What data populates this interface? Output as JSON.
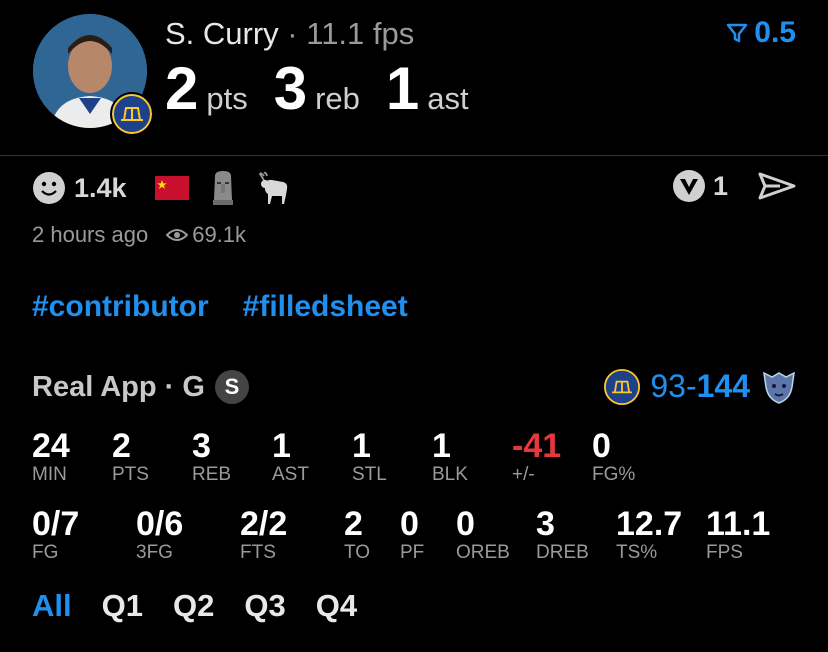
{
  "player": {
    "name": "S. Curry",
    "separator": " · ",
    "fps": "11.1 fps",
    "pts": "2",
    "pts_label": "pts",
    "reb": "3",
    "reb_label": "reb",
    "ast": "1",
    "ast_label": "ast"
  },
  "filter": {
    "icon": "filter-icon",
    "value": "0.5",
    "color": "#1f8ff0"
  },
  "reactions": {
    "smiley_count": "1.4k",
    "items": [
      "smiley-icon",
      "china-flag-icon",
      "moai-icon",
      "goat-icon"
    ]
  },
  "meta": {
    "time": "2 hours ago",
    "views": "69.1k"
  },
  "actions": {
    "vote_count": "1"
  },
  "tags": [
    "#contributor",
    "#filledsheet"
  ],
  "game": {
    "app": "Real App · G",
    "badge": "S",
    "home_score": "93",
    "dash": "-",
    "away_score": "144"
  },
  "row1": [
    {
      "v": "24",
      "l": "MIN"
    },
    {
      "v": "2",
      "l": "PTS"
    },
    {
      "v": "3",
      "l": "REB"
    },
    {
      "v": "1",
      "l": "AST"
    },
    {
      "v": "1",
      "l": "STL"
    },
    {
      "v": "1",
      "l": "BLK"
    },
    {
      "v": "-41",
      "l": "+/-"
    },
    {
      "v": "0",
      "l": "FG%"
    }
  ],
  "row2": [
    {
      "v": "0/7",
      "l": "FG"
    },
    {
      "v": "0/6",
      "l": "3FG"
    },
    {
      "v": "2/2",
      "l": "FTS"
    },
    {
      "v": "2",
      "l": "TO"
    },
    {
      "v": "0",
      "l": "PF"
    },
    {
      "v": "0",
      "l": "OREB"
    },
    {
      "v": "3",
      "l": "DREB"
    },
    {
      "v": "12.7",
      "l": "TS%"
    },
    {
      "v": "11.1",
      "l": "FPS"
    }
  ],
  "quarters": [
    "All",
    "Q1",
    "Q2",
    "Q3",
    "Q4"
  ],
  "colors": {
    "accent": "#1f8ff0",
    "negative": "#e5373f"
  }
}
